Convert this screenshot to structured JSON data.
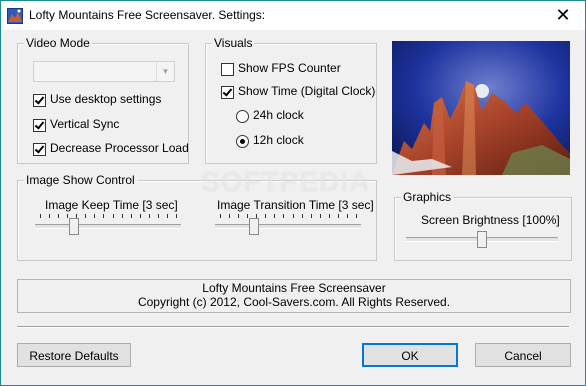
{
  "window": {
    "title": "Lofty Mountains Free Screensaver. Settings:",
    "close_glyph": "✕"
  },
  "video_mode": {
    "label": "Video Mode",
    "combo_value": "",
    "options": [
      {
        "label": "Use desktop settings",
        "checked": true
      },
      {
        "label": "Vertical Sync",
        "checked": true
      },
      {
        "label": "Decrease Processor Load",
        "checked": true
      }
    ]
  },
  "visuals": {
    "label": "Visuals",
    "show_fps": {
      "label": "Show FPS Counter",
      "checked": false
    },
    "show_time": {
      "label": "Show Time (Digital Clock)",
      "checked": true
    },
    "clock_24h": {
      "label": "24h clock",
      "selected": false
    },
    "clock_12h": {
      "label": "12h clock",
      "selected": true
    }
  },
  "image_show": {
    "label": "Image Show Control",
    "keep_time": {
      "label": "Image Keep Time [3 sec]",
      "level": 0.25
    },
    "transition_time": {
      "label": "Image Transition Time [3 sec]",
      "level": 0.25
    }
  },
  "graphics": {
    "label": "Graphics",
    "brightness": {
      "label": "Screen Brightness [100%]",
      "level": 0.5
    }
  },
  "info": {
    "line1": "Lofty Mountains Free Screensaver",
    "line2": "Copyright (c) 2012, Cool-Savers.com. All Rights Reserved."
  },
  "buttons": {
    "restore": "Restore Defaults",
    "ok": "OK",
    "cancel": "Cancel"
  },
  "watermark": "SOFTPEDIA",
  "colors": {
    "accent": "#0078d7",
    "frame": "#1e8a8a",
    "sky": "#1c2f8c",
    "rock": "#b8502e"
  }
}
